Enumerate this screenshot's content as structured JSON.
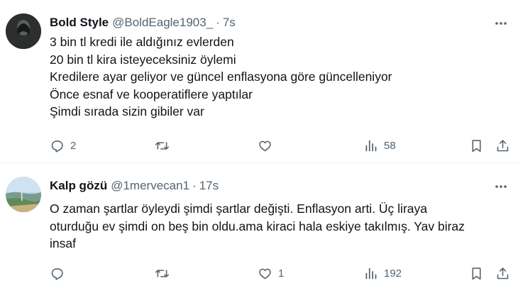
{
  "tweets": [
    {
      "name": "Bold Style",
      "handle": "@BoldEagle1903_",
      "separator": "·",
      "time": "7s",
      "lines": [
        "3 bin tl kredi ile aldığınız evlerden",
        "20 bin tl kira isteyeceksiniz öylemi",
        "Kredilere ayar geliyor ve güncel enflasyona göre güncelleniyor",
        "Önce esnaf ve kooperatiflere yaptılar",
        "Şimdi sırada sizin gibiler var"
      ],
      "replies": "2",
      "retweets": "",
      "likes": "",
      "views": "58"
    },
    {
      "name": "Kalp gözü",
      "handle": "@1mervecan1",
      "separator": "·",
      "time": "17s",
      "lines": [
        "O zaman şartlar öyleydi şimdi şartlar değişti. Enflasyon arti.  Üç liraya",
        "oturduğu ev şimdi on beş bin oldu.ama kiraci hala eskiye takılmış. Yav biraz",
        "insaf"
      ],
      "replies": "",
      "retweets": "",
      "likes": "1",
      "views": "192"
    }
  ],
  "icons": {
    "more": "more-dots-icon",
    "reply": "reply-bubble-icon",
    "retweet": "retweet-arrows-icon",
    "like": "heart-icon",
    "views": "views-bar-chart-icon",
    "bookmark": "bookmark-icon",
    "share": "share-upload-icon"
  },
  "colors": {
    "text": "#0f1419",
    "secondary": "#536471",
    "divider": "#eff3f4"
  }
}
